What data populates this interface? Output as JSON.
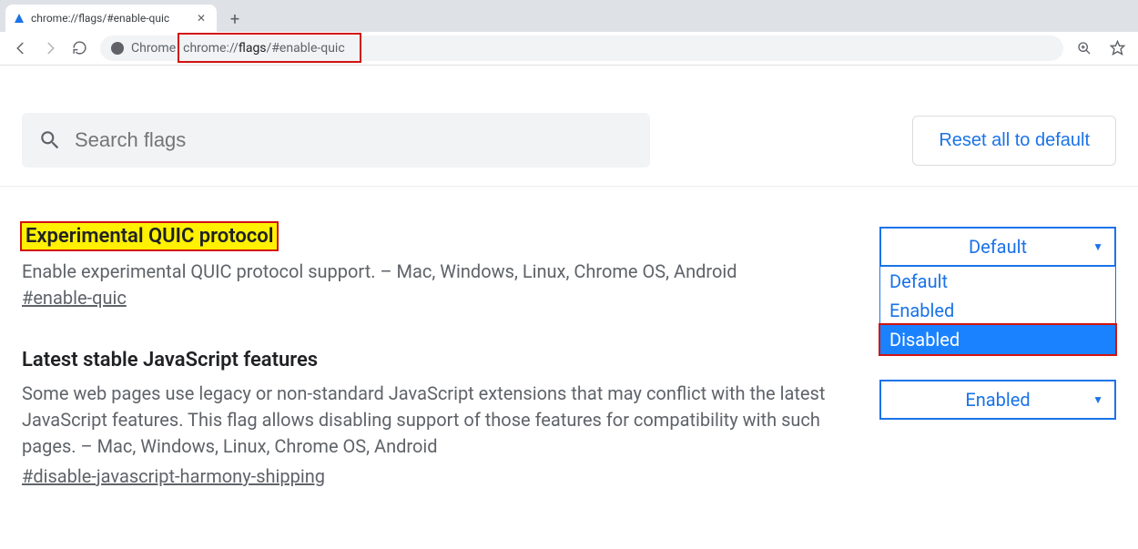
{
  "browser": {
    "tab_title": "chrome://flags/#enable-quic",
    "chrome_label": "Chrome",
    "url_prefix": "chrome://",
    "url_bold": "flags",
    "url_suffix": "/#enable-quic"
  },
  "header": {
    "search_placeholder": "Search flags",
    "reset_label": "Reset all to default"
  },
  "flags": [
    {
      "title": "Experimental QUIC protocol",
      "highlight": true,
      "description": "Enable experimental QUIC protocol support. – Mac, Windows, Linux, Chrome OS, Android",
      "anchor": "#enable-quic",
      "selected": "Default",
      "dropdown_open": true,
      "options": [
        "Default",
        "Enabled",
        "Disabled"
      ],
      "highlighted_option": "Disabled"
    },
    {
      "title": "Latest stable JavaScript features",
      "highlight": false,
      "description": "Some web pages use legacy or non-standard JavaScript extensions that may conflict with the latest JavaScript features. This flag allows disabling support of those features for compatibility with such pages. – Mac, Windows, Linux, Chrome OS, Android",
      "anchor": "#disable-javascript-harmony-shipping",
      "selected": "Enabled",
      "dropdown_open": false
    }
  ]
}
